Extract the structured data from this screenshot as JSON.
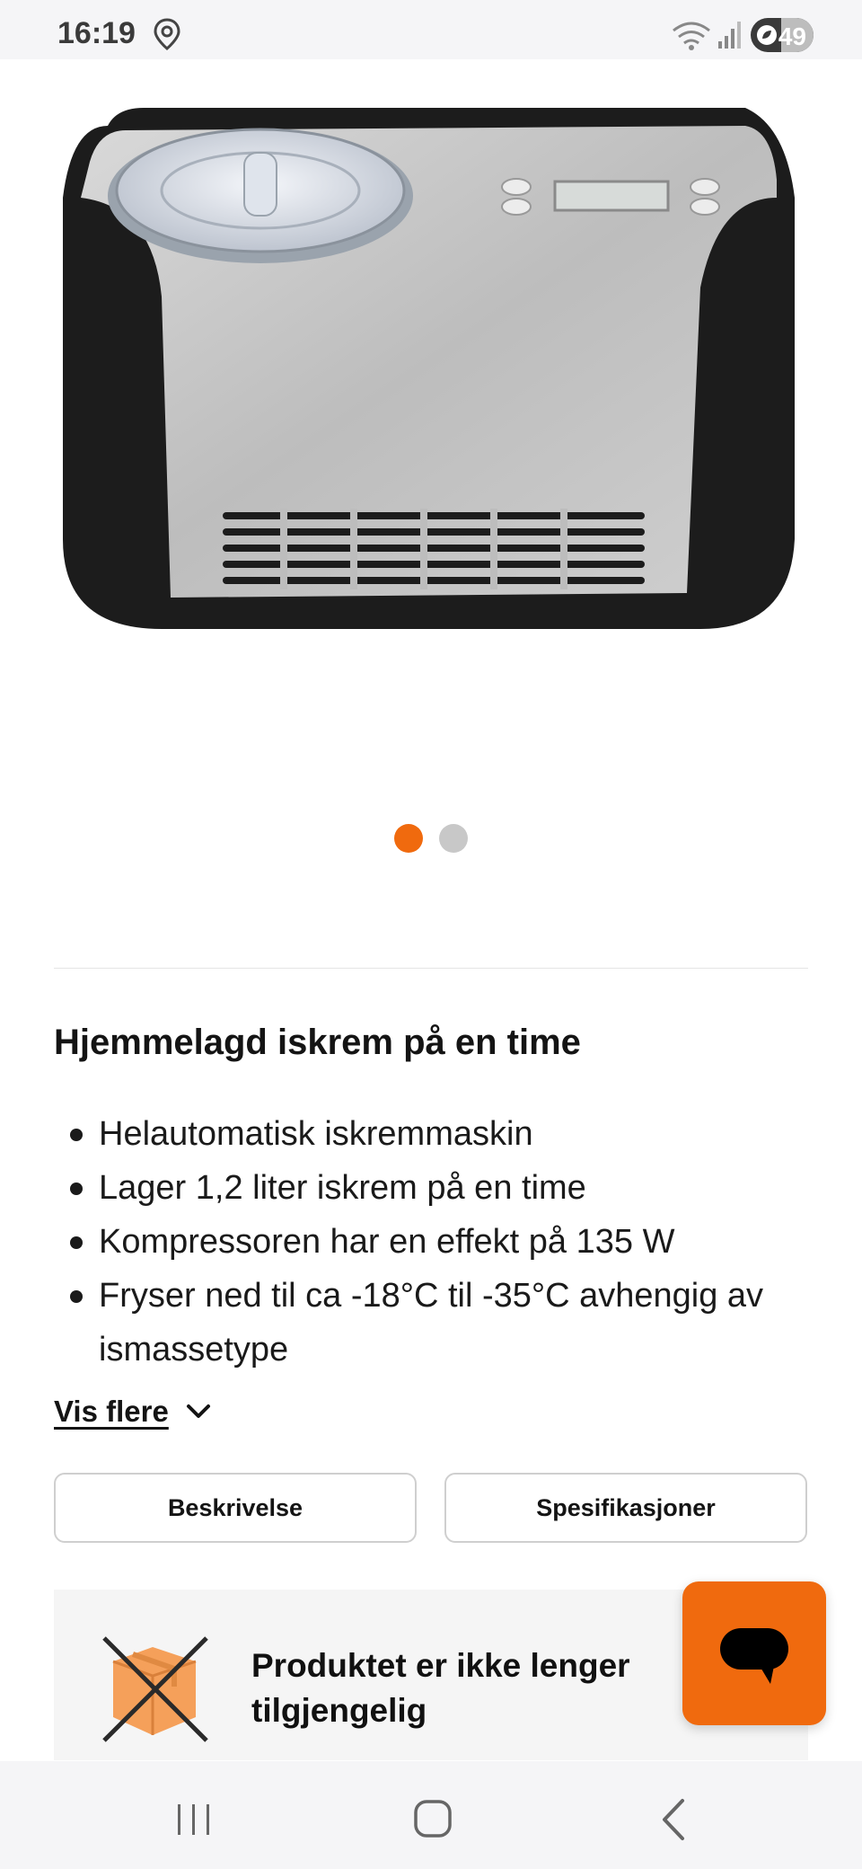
{
  "status_bar": {
    "time": "16:19",
    "battery_level": 49,
    "battery_text": "49",
    "icons": [
      "location-icon",
      "wifi-icon",
      "signal-icon",
      "battery-saver-icon"
    ]
  },
  "product": {
    "image_icon": "ice-cream-machine-image",
    "carousel": {
      "total": 2,
      "active_index": 0
    }
  },
  "content": {
    "heading": "Hjemmelagd iskrem på en time",
    "features": [
      "Helautomatisk iskremmaskin",
      "Lager 1,2 liter iskrem på en time",
      "Kompressoren har en effekt på 135 W",
      "Fryser ned til ca -18°C til -35°C avhengig av ismassetype"
    ],
    "show_more_label": "Vis flere"
  },
  "tabs": {
    "description_label": "Beskrivelse",
    "specifications_label": "Spesifikasjoner"
  },
  "availability": {
    "message": "Produktet er ikke lenger tilgjengelig",
    "icon": "unavailable-box-icon"
  },
  "chat": {
    "icon": "chat-icon"
  },
  "colors": {
    "accent": "#f06a0e",
    "dot_inactive": "#c8c8c8",
    "box": "#f5a05a"
  }
}
